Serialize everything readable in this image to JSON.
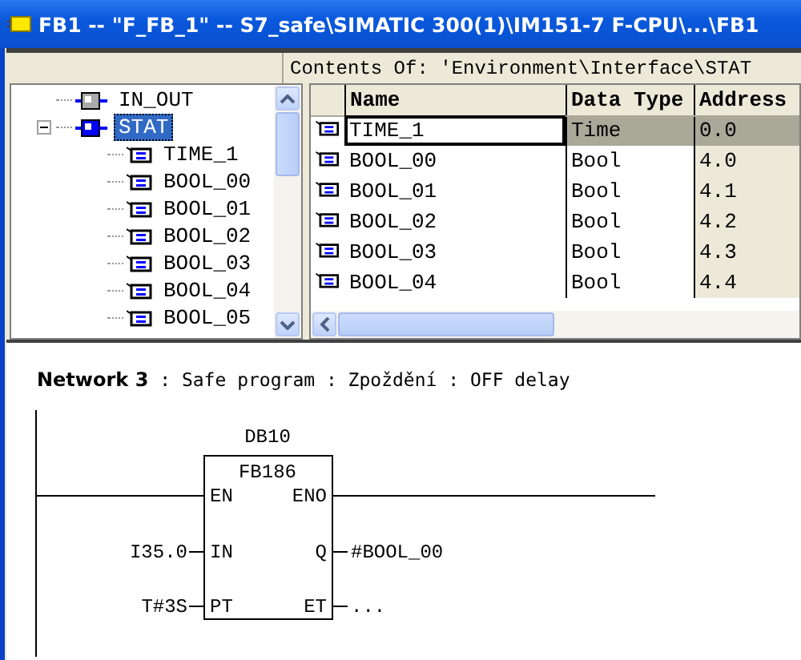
{
  "window": {
    "title": "FB1 -- \"F_FB_1\" -- S7_safe\\SIMATIC 300(1)\\IM151-7 F-CPU\\...\\FB1"
  },
  "contents_header": "Contents Of: 'Environment\\Interface\\STAT",
  "tree": {
    "items": [
      {
        "label": "IN_OUT",
        "kind": "section",
        "selected": false
      },
      {
        "label": "STAT",
        "kind": "section",
        "selected": true,
        "expanded": true,
        "children": [
          {
            "label": "TIME_1",
            "kind": "variable",
            "selected": false
          },
          {
            "label": "BOOL_00",
            "kind": "variable",
            "selected": false
          },
          {
            "label": "BOOL_01",
            "kind": "variable",
            "selected": false
          },
          {
            "label": "BOOL_02",
            "kind": "variable",
            "selected": false
          },
          {
            "label": "BOOL_03",
            "kind": "variable",
            "selected": false
          },
          {
            "label": "BOOL_04",
            "kind": "variable",
            "selected": false
          },
          {
            "label": "BOOL_05",
            "kind": "variable",
            "selected": false
          }
        ]
      }
    ]
  },
  "table": {
    "columns": [
      "Name",
      "Data Type",
      "Address"
    ],
    "rows": [
      {
        "name": "TIME_1",
        "data_type": "Time",
        "address": "0.0",
        "selected": true
      },
      {
        "name": "BOOL_00",
        "data_type": "Bool",
        "address": "4.0",
        "selected": false
      },
      {
        "name": "BOOL_01",
        "data_type": "Bool",
        "address": "4.1",
        "selected": false
      },
      {
        "name": "BOOL_02",
        "data_type": "Bool",
        "address": "4.2",
        "selected": false
      },
      {
        "name": "BOOL_03",
        "data_type": "Bool",
        "address": "4.3",
        "selected": false
      },
      {
        "name": "BOOL_04",
        "data_type": "Bool",
        "address": "4.4",
        "selected": false
      }
    ]
  },
  "network": {
    "title": "**Network 3** : Safe program : Zpoždění : OFF delay",
    "block": {
      "instance": "DB10",
      "type": "FB186",
      "inputs": [
        {
          "pin": "EN"
        },
        {
          "pin": "IN",
          "operand": "I35.0"
        },
        {
          "pin": "PT",
          "operand": "T#3S"
        }
      ],
      "outputs": [
        {
          "pin": "ENO"
        },
        {
          "pin": "Q",
          "operand": "#BOOL_00"
        },
        {
          "pin": "ET",
          "operand": "..."
        }
      ]
    }
  }
}
